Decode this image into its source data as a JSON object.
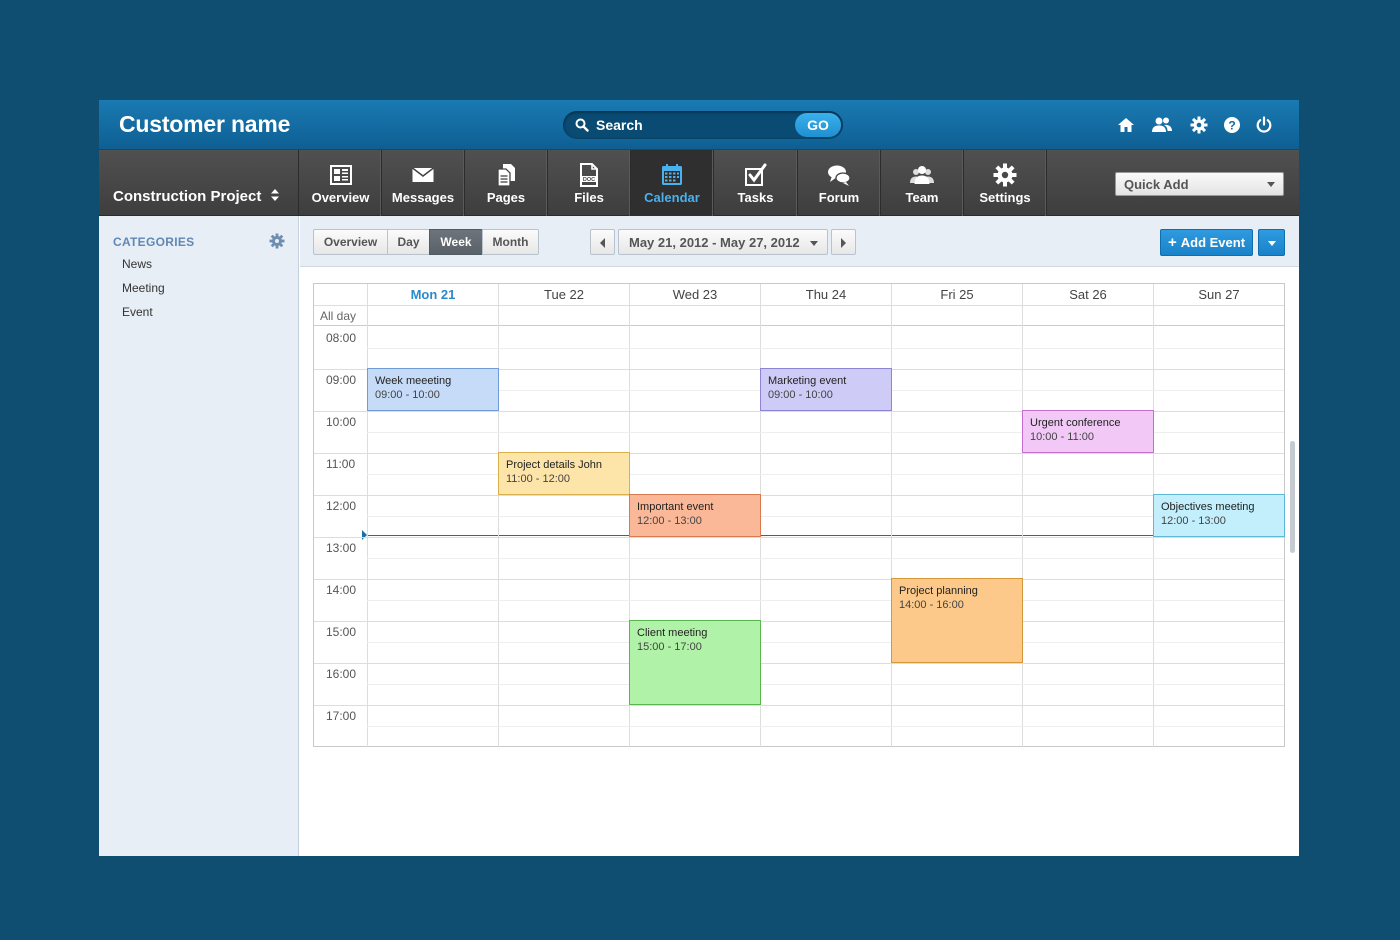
{
  "header": {
    "customer_name": "Customer name",
    "search_placeholder": "Search",
    "search_button": "GO",
    "icons": [
      "home-icon",
      "team-icon",
      "settings-icon",
      "help-icon",
      "power-icon"
    ]
  },
  "nav": {
    "project": "Construction Project",
    "items": [
      {
        "label": "Overview",
        "icon": "overview-icon"
      },
      {
        "label": "Messages",
        "icon": "envelope-icon"
      },
      {
        "label": "Pages",
        "icon": "pages-icon"
      },
      {
        "label": "Files",
        "icon": "doc-file-icon"
      },
      {
        "label": "Calendar",
        "icon": "calendar-icon"
      },
      {
        "label": "Tasks",
        "icon": "checkbox-icon"
      },
      {
        "label": "Forum",
        "icon": "speech-bubbles-icon"
      },
      {
        "label": "Team",
        "icon": "people-icon"
      },
      {
        "label": "Settings",
        "icon": "gear-icon"
      }
    ],
    "active": "Calendar",
    "quick_add": "Quick Add"
  },
  "sidebar": {
    "title": "CATEGORIES",
    "items": [
      "News",
      "Meeting",
      "Event"
    ]
  },
  "toolbar": {
    "views": [
      "Overview",
      "Day",
      "Week",
      "Month"
    ],
    "active_view": "Week",
    "date_range": "May 21, 2012 - May 27, 2012",
    "add_event": "Add Event"
  },
  "calendar": {
    "days": [
      "Mon 21",
      "Tue 22",
      "Wed 23",
      "Thu 24",
      "Fri 25",
      "Sat 26",
      "Sun 27"
    ],
    "today": "Mon 21",
    "all_day_label": "All day",
    "hours": [
      "08:00",
      "09:00",
      "10:00",
      "11:00",
      "12:00",
      "13:00",
      "14:00",
      "15:00",
      "16:00",
      "17:00"
    ],
    "current_time": "13:00",
    "events": [
      {
        "title": "Week meeeting",
        "time": "09:00 - 10:00",
        "day": "Mon 21",
        "start": 9,
        "end": 10,
        "bg": "#c6dbf7",
        "border": "#6f9bd6"
      },
      {
        "title": "Marketing event",
        "time": "09:00 - 10:00",
        "day": "Thu 24",
        "start": 9,
        "end": 10,
        "bg": "#cfcbf7",
        "border": "#8c85d6"
      },
      {
        "title": "Urgent conference",
        "time": "10:00 - 11:00",
        "day": "Sat 26",
        "start": 10,
        "end": 11,
        "bg": "#f1c8f6",
        "border": "#c36fd0"
      },
      {
        "title": "Project details John",
        "time": "11:00 - 12:00",
        "day": "Tue 22",
        "start": 11,
        "end": 12,
        "bg": "#fde4a8",
        "border": "#d8b04e"
      },
      {
        "title": "Important event",
        "time": "12:00 - 13:00",
        "day": "Wed 23",
        "start": 12,
        "end": 13,
        "bg": "#fbb898",
        "border": "#d97a51"
      },
      {
        "title": "Objectives meeting",
        "time": "12:00 - 13:00",
        "day": "Sun 27",
        "start": 12,
        "end": 13,
        "bg": "#c3eefb",
        "border": "#5fb9d6"
      },
      {
        "title": "Project planning",
        "time": "14:00 - 16:00",
        "day": "Fri 25",
        "start": 14,
        "end": 16,
        "bg": "#fdc98a",
        "border": "#d6963a"
      },
      {
        "title": "Client meeting",
        "time": "15:00 - 17:00",
        "day": "Wed 23",
        "start": 15,
        "end": 17,
        "bg": "#b0f2a7",
        "border": "#5bb64f"
      }
    ]
  }
}
